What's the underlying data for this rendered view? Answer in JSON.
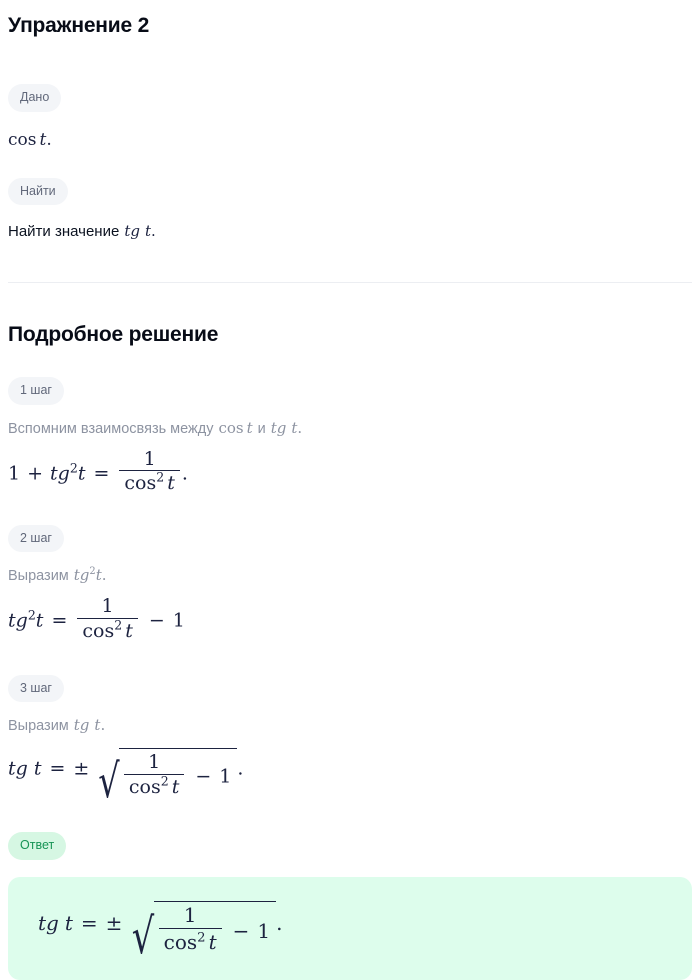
{
  "exercise": {
    "title": "Упражнение 2",
    "given": {
      "badge": "Дано",
      "math_plain": "cos t."
    },
    "find": {
      "badge": "Найти",
      "text_prefix": "Найти значение",
      "math_plain": "tg t."
    }
  },
  "solution": {
    "heading": "Подробное решение",
    "steps": [
      {
        "badge": "1 шаг",
        "description_prefix": "Вспомним взаимосвязь между",
        "description_math_1": "cos t",
        "description_join": "и",
        "description_math_2": "tg t.",
        "formula_plain": "1 + tg^2 t = 1 / cos^2 t ."
      },
      {
        "badge": "2 шаг",
        "description_prefix": "Выразим",
        "description_math_1": "tg^2 t.",
        "formula_plain": "tg^2 t = 1 / cos^2 t − 1"
      },
      {
        "badge": "3 шаг",
        "description_prefix": "Выразим",
        "description_math_1": "tg t.",
        "formula_plain": "tg t = ± sqrt( 1 / cos^2 t − 1 )."
      }
    ]
  },
  "answer": {
    "badge": "Ответ",
    "formula_plain": "tg t = ± sqrt( 1 / cos^2 t − 1 )."
  },
  "symbols": {
    "one": "1",
    "plus": "+",
    "minus": "−",
    "equals": "=",
    "plusminus": "±",
    "period": ".",
    "radical": "√",
    "cos": "cos",
    "tg": "tg",
    "t": "t",
    "two": "2",
    "and_ru": "и"
  },
  "colors": {
    "page_bg": "#ffffff",
    "heading": "#080c17",
    "badge_bg": "#f3f5f8",
    "badge_text": "#61687a",
    "answer_badge_bg": "#d6f7e3",
    "answer_badge_text": "#179455",
    "answer_box_bg": "#ddfdec",
    "math": "#1d2340",
    "muted_text": "#8d93a1",
    "divider": "#eceef2"
  }
}
